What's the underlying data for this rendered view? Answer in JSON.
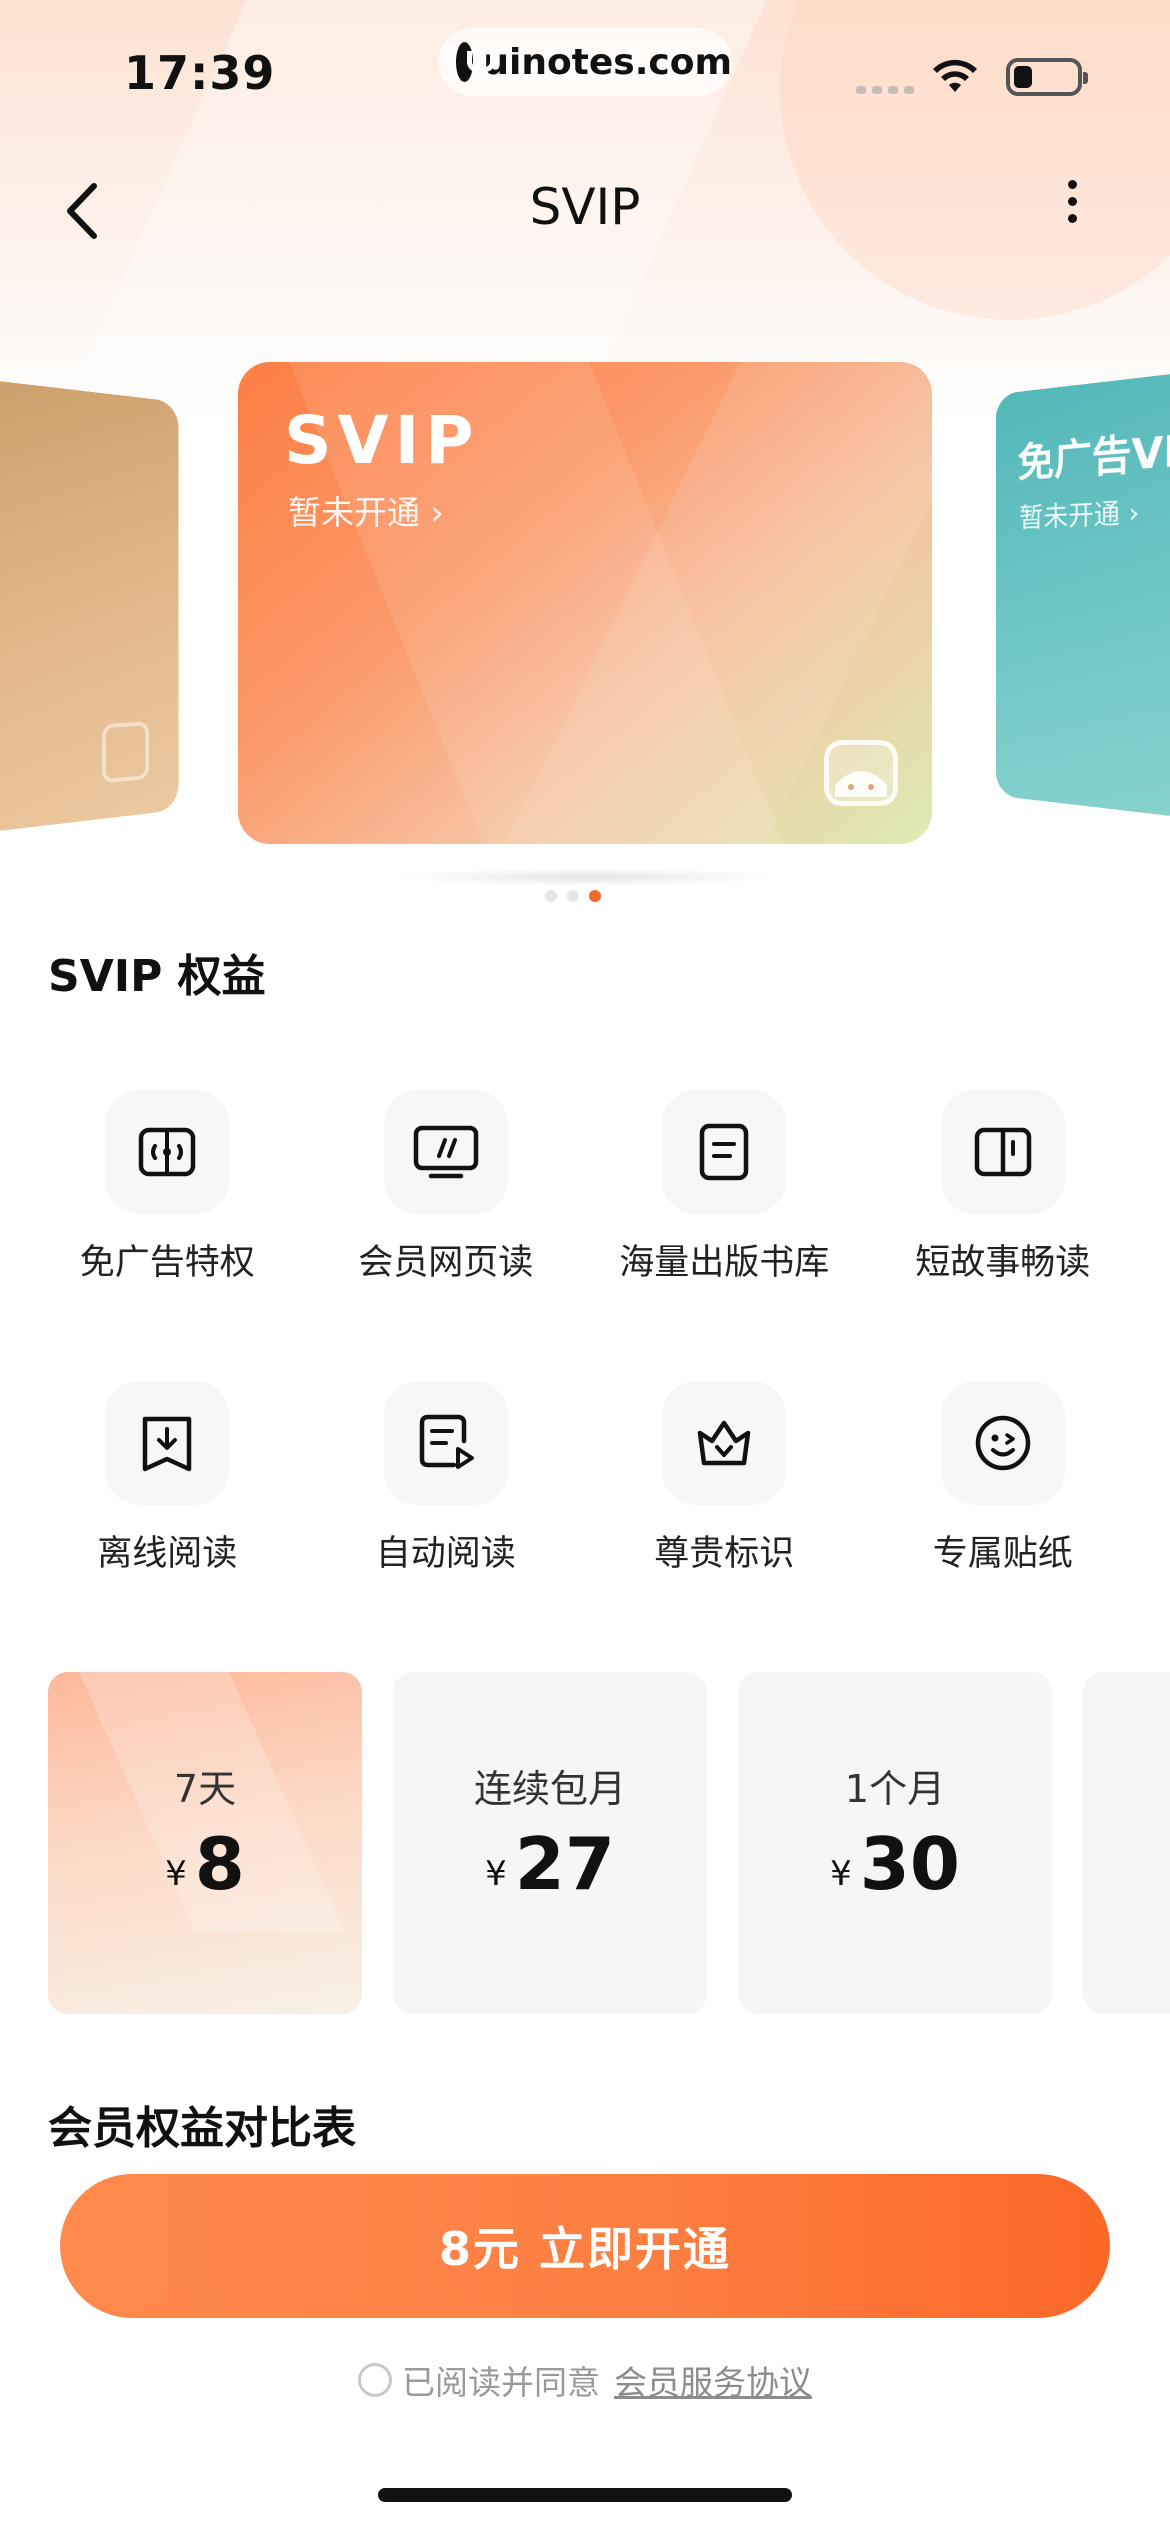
{
  "status_bar": {
    "time": "17:39",
    "url": "uinotes.com"
  },
  "nav": {
    "title": "SVIP"
  },
  "cards": {
    "main": {
      "brand": "SVIP",
      "status": "暂未开通 ›"
    },
    "right": {
      "title": "免广告VIP",
      "status": "暂未开通 ›"
    },
    "carousel_dots": 3,
    "active_dot": 2
  },
  "benefits": {
    "title": "SVIP 权益",
    "items": [
      {
        "label": "免广告特权",
        "icon": "ad-free-icon"
      },
      {
        "label": "会员网页读",
        "icon": "web-read-icon"
      },
      {
        "label": "海量出版书库",
        "icon": "library-icon"
      },
      {
        "label": "短故事畅读",
        "icon": "book-icon"
      },
      {
        "label": "离线阅读",
        "icon": "offline-download-icon"
      },
      {
        "label": "自动阅读",
        "icon": "auto-read-icon"
      },
      {
        "label": "尊贵标识",
        "icon": "crown-icon"
      },
      {
        "label": "专属贴纸",
        "icon": "sticker-icon"
      }
    ]
  },
  "plans": [
    {
      "name": "7天",
      "currency": "¥",
      "price": "8",
      "selected": true
    },
    {
      "name": "连续包月",
      "currency": "¥",
      "price": "27",
      "selected": false
    },
    {
      "name": "1个月",
      "currency": "¥",
      "price": "30",
      "selected": false
    },
    {
      "name": "",
      "currency": "",
      "price": "",
      "selected": false
    }
  ],
  "compare": {
    "title": "会员权益对比表"
  },
  "cta": {
    "label": "8元 立即开通"
  },
  "agreement": {
    "text": "已阅读并同意",
    "link": "会员服务协议"
  },
  "colors": {
    "accent": "#fd7f42",
    "active_dot": "#f26a2f"
  }
}
